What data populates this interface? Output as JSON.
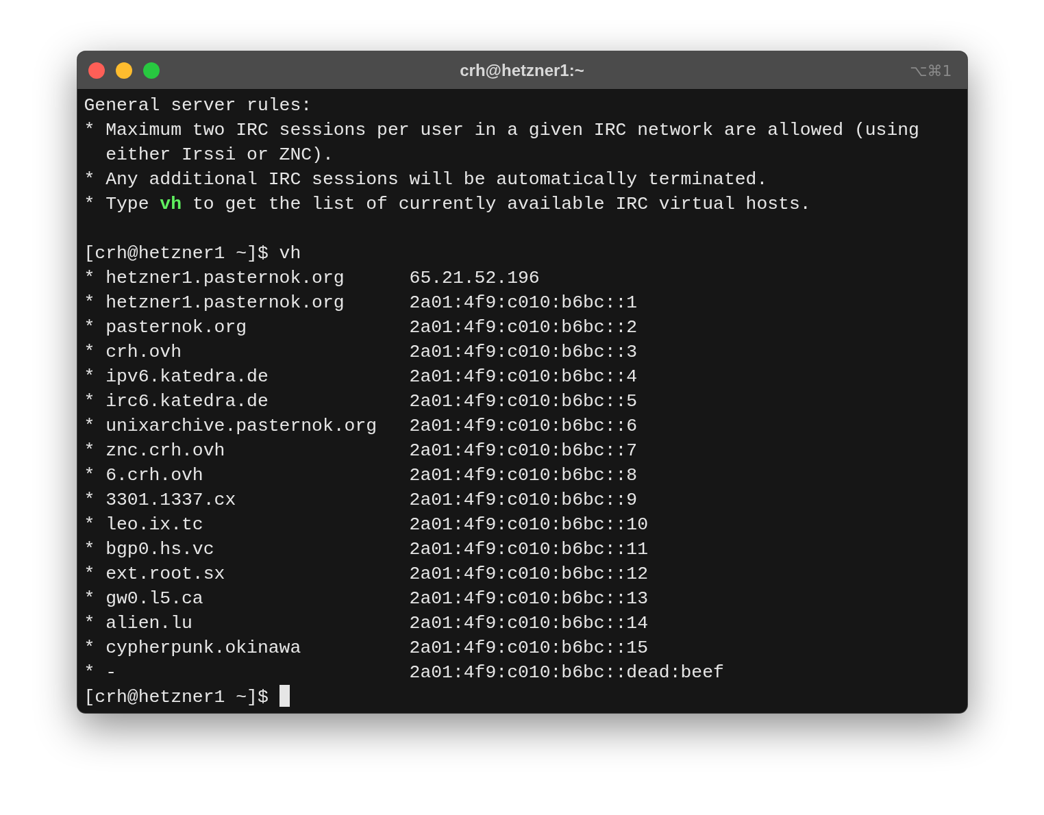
{
  "window": {
    "title": "crh@hetzner1:~",
    "shortcut": "⌥⌘1"
  },
  "motd": [
    {
      "segments": [
        {
          "text": "General server rules:"
        }
      ]
    },
    {
      "segments": [
        {
          "text": "* Maximum two IRC sessions per user in a given IRC network are allowed (using"
        }
      ]
    },
    {
      "segments": [
        {
          "text": "  either Irssi or ZNC)."
        }
      ]
    },
    {
      "segments": [
        {
          "text": "* Any additional IRC sessions will be automatically terminated."
        }
      ]
    },
    {
      "segments": [
        {
          "text": "* Type "
        },
        {
          "text": "vh",
          "kind": "command"
        },
        {
          "text": " to get the list of currently available IRC virtual hosts."
        }
      ]
    }
  ],
  "command_prompt": {
    "prompt": "[crh@hetzner1 ~]$",
    "command": "vh"
  },
  "hosts": [
    {
      "bullet": "*",
      "host": "hetzner1.pasternok.org",
      "address": "65.21.52.196"
    },
    {
      "bullet": "*",
      "host": "hetzner1.pasternok.org",
      "address": "2a01:4f9:c010:b6bc::1"
    },
    {
      "bullet": "*",
      "host": "pasternok.org",
      "address": "2a01:4f9:c010:b6bc::2"
    },
    {
      "bullet": "*",
      "host": "crh.ovh",
      "address": "2a01:4f9:c010:b6bc::3"
    },
    {
      "bullet": "*",
      "host": "ipv6.katedra.de",
      "address": "2a01:4f9:c010:b6bc::4"
    },
    {
      "bullet": "*",
      "host": "irc6.katedra.de",
      "address": "2a01:4f9:c010:b6bc::5"
    },
    {
      "bullet": "*",
      "host": "unixarchive.pasternok.org",
      "address": "2a01:4f9:c010:b6bc::6"
    },
    {
      "bullet": "*",
      "host": "znc.crh.ovh",
      "address": "2a01:4f9:c010:b6bc::7"
    },
    {
      "bullet": "*",
      "host": "6.crh.ovh",
      "address": "2a01:4f9:c010:b6bc::8"
    },
    {
      "bullet": "*",
      "host": "3301.1337.cx",
      "address": "2a01:4f9:c010:b6bc::9"
    },
    {
      "bullet": "*",
      "host": "leo.ix.tc",
      "address": "2a01:4f9:c010:b6bc::10"
    },
    {
      "bullet": "*",
      "host": "bgp0.hs.vc",
      "address": "2a01:4f9:c010:b6bc::11"
    },
    {
      "bullet": "*",
      "host": "ext.root.sx",
      "address": "2a01:4f9:c010:b6bc::12"
    },
    {
      "bullet": "*",
      "host": "gw0.l5.ca",
      "address": "2a01:4f9:c010:b6bc::13"
    },
    {
      "bullet": "*",
      "host": "alien.lu",
      "address": "2a01:4f9:c010:b6bc::14"
    },
    {
      "bullet": "*",
      "host": "cypherpunk.okinawa",
      "address": "2a01:4f9:c010:b6bc::15"
    },
    {
      "bullet": "*",
      "host": "-",
      "address": "2a01:4f9:c010:b6bc::dead:beef"
    }
  ],
  "final_prompt": {
    "prompt": "[crh@hetzner1 ~]$",
    "cursor": true
  }
}
